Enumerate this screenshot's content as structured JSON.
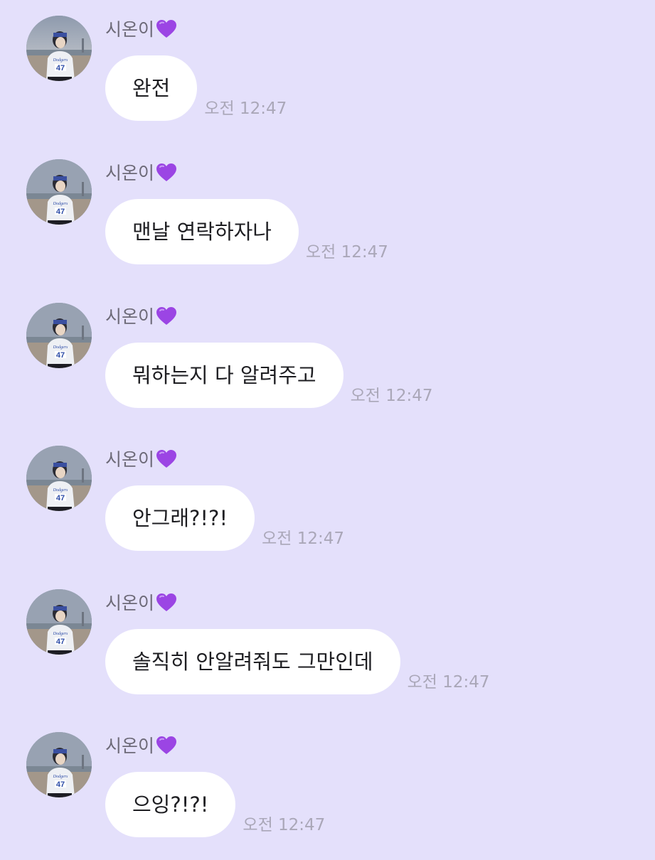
{
  "colors": {
    "background": "#e4e0fb",
    "bubble": "#ffffff",
    "sender_text": "#6d6a78",
    "time_text": "#aaa7b8",
    "heart": "#9b45e4"
  },
  "messages": [
    {
      "sender": "시온이",
      "sender_emoji": "purple-heart",
      "text": "완전",
      "time": "오전 12:47"
    },
    {
      "sender": "시온이",
      "sender_emoji": "purple-heart",
      "text": "맨날 연락하자나",
      "time": "오전 12:47"
    },
    {
      "sender": "시온이",
      "sender_emoji": "purple-heart",
      "text": "뭐하는지 다 알려주고",
      "time": "오전 12:47"
    },
    {
      "sender": "시온이",
      "sender_emoji": "purple-heart",
      "text": "안그래?!?!",
      "time": "오전 12:47"
    },
    {
      "sender": "시온이",
      "sender_emoji": "purple-heart",
      "text": "솔직히 안알려줘도 그만인데",
      "time": "오전 12:47"
    },
    {
      "sender": "시온이",
      "sender_emoji": "purple-heart",
      "text": "으잉?!?!",
      "time": "오전 12:47"
    }
  ],
  "avatar": {
    "jersey_number": "47",
    "jersey_script": "Dodgers"
  }
}
